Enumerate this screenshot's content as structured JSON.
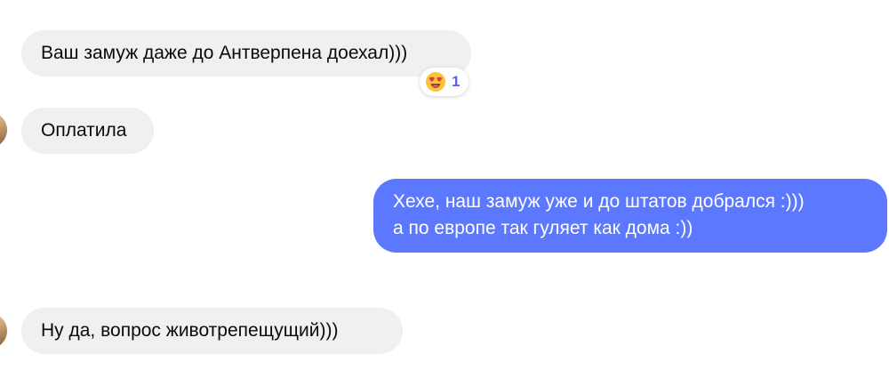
{
  "messages": [
    {
      "direction": "incoming",
      "text": "Ваш замуж даже до Антверпена доехал)))"
    },
    {
      "direction": "incoming",
      "text": "Оплатила"
    },
    {
      "direction": "outgoing",
      "lines": [
        "Хехе, наш замуж уже и до штатов добрался :)))",
        "а по европе так гуляет как дома :))"
      ]
    },
    {
      "direction": "incoming",
      "text": "Ну да, вопрос животрепещущий)))"
    }
  ],
  "reaction": {
    "icon": "heart-eyes-emoji-icon",
    "count": "1"
  },
  "colors": {
    "incoming_bubble": "#f0f0f0",
    "outgoing_bubble": "#5b78ff",
    "reaction_count": "#5b62e8"
  }
}
